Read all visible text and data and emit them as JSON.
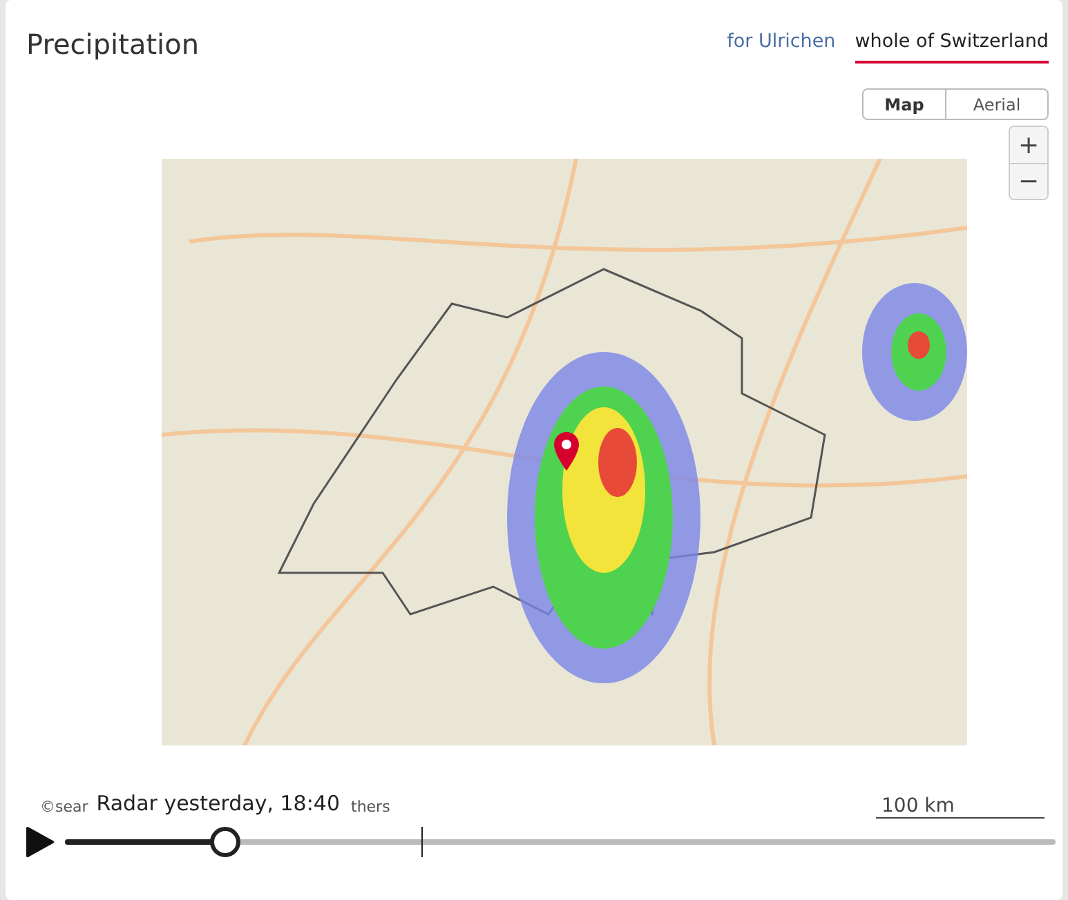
{
  "title": "Precipitation",
  "scope_tabs": [
    {
      "label": "for Ulrichen",
      "selected": false
    },
    {
      "label": "whole of Switzerland",
      "selected": true
    }
  ],
  "map_type": [
    {
      "label": "Map",
      "selected": true
    },
    {
      "label": "Aerial",
      "selected": false
    }
  ],
  "zoom": {
    "in": "+",
    "out": "−"
  },
  "attribution": {
    "before": "©sear",
    "after": "thers"
  },
  "radar_time": "Radar yesterday, 18:40",
  "scale": "100 km",
  "timeline": {
    "level": 0.16
  }
}
